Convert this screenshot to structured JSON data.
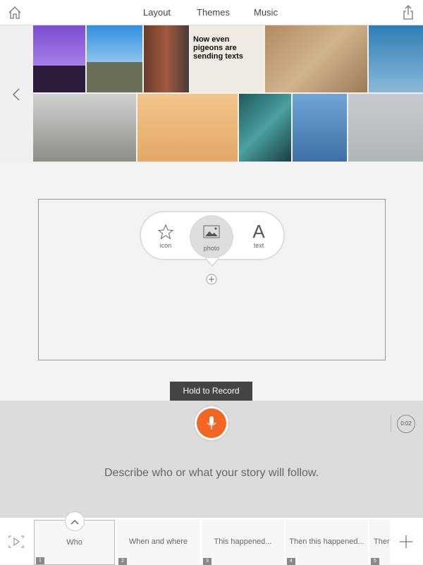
{
  "topbar": {
    "tabs": [
      {
        "label": "Layout"
      },
      {
        "label": "Themes"
      },
      {
        "label": "Music"
      }
    ],
    "home_icon": "home-icon",
    "share_icon": "share-icon"
  },
  "photos": {
    "newspaper_headline": "Now even pigeons are sending texts",
    "prev_icon": "chevron-left-icon"
  },
  "picker": {
    "options": [
      {
        "label": "icon"
      },
      {
        "label": "photo"
      },
      {
        "label": "text"
      }
    ],
    "add_icon": "plus-circle-icon"
  },
  "record": {
    "tooltip": "Hold to Record",
    "timer": "0:02",
    "prompt": "Describe who or what your story will follow.",
    "accent": "#f26522"
  },
  "storyline": {
    "cards": [
      {
        "label": "Who",
        "num": "1"
      },
      {
        "label": "When and where",
        "num": "2"
      },
      {
        "label": "This happened...",
        "num": "3"
      },
      {
        "label": "Then this happened...",
        "num": "4"
      },
      {
        "label": "Then",
        "num": "5"
      }
    ]
  }
}
